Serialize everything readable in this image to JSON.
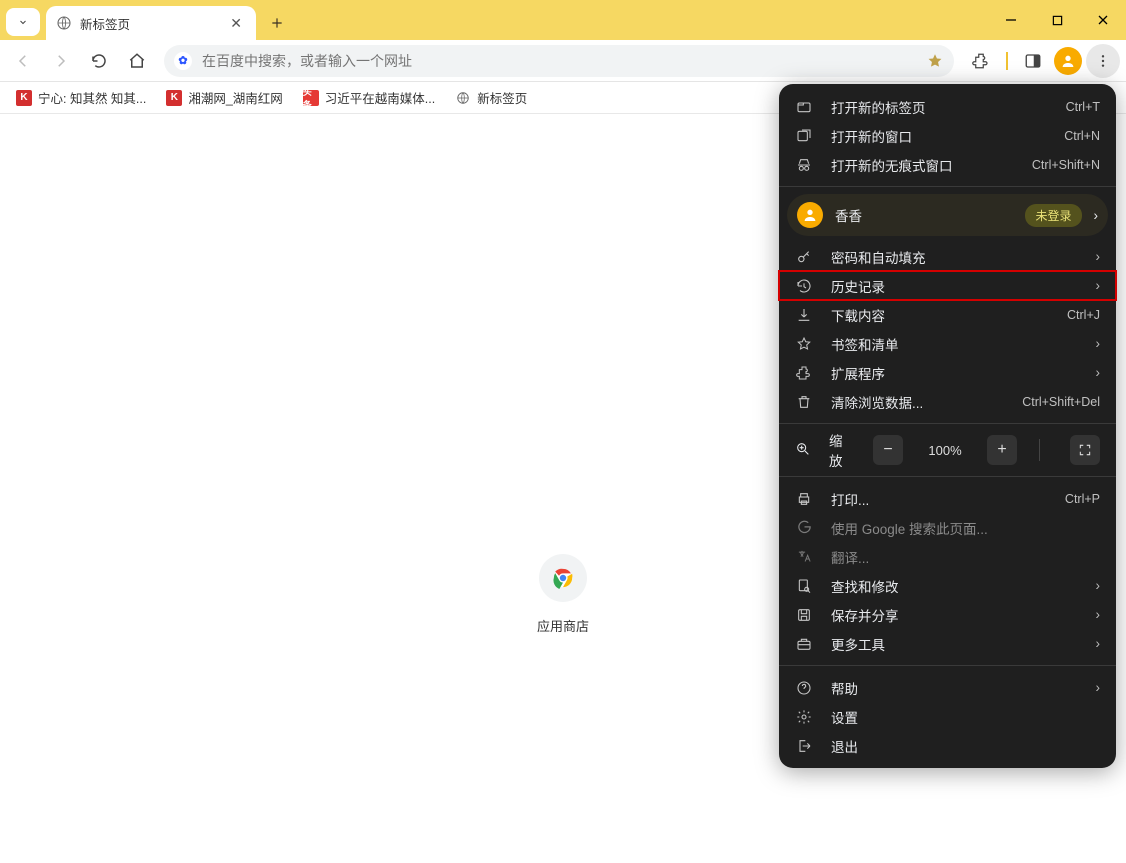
{
  "window": {
    "title": "新标签页"
  },
  "tab": {
    "label": "新标签页"
  },
  "addressbar": {
    "placeholder": "在百度中搜索，或者输入一个网址"
  },
  "bookmarks": [
    {
      "label": "宁心: 知其然 知其...",
      "icon": "red"
    },
    {
      "label": "湘潮网_湖南红网",
      "icon": "red"
    },
    {
      "label": "习近平在越南媒体...",
      "icon": "orange"
    },
    {
      "label": "新标签页",
      "icon": "globe"
    }
  ],
  "content": {
    "tile_label": "应用商店"
  },
  "menu": {
    "new_tab": {
      "label": "打开新的标签页",
      "shortcut": "Ctrl+T"
    },
    "new_window": {
      "label": "打开新的窗口",
      "shortcut": "Ctrl+N"
    },
    "incognito": {
      "label": "打开新的无痕式窗口",
      "shortcut": "Ctrl+Shift+N"
    },
    "profile": {
      "name": "香香",
      "badge": "未登录"
    },
    "passwords": {
      "label": "密码和自动填充"
    },
    "history": {
      "label": "历史记录"
    },
    "downloads": {
      "label": "下载内容",
      "shortcut": "Ctrl+J"
    },
    "bookmarks": {
      "label": "书签和清单"
    },
    "extensions": {
      "label": "扩展程序"
    },
    "clear_data": {
      "label": "清除浏览数据...",
      "shortcut": "Ctrl+Shift+Del"
    },
    "zoom": {
      "label": "缩放",
      "value": "100%"
    },
    "print": {
      "label": "打印...",
      "shortcut": "Ctrl+P"
    },
    "google_search": {
      "label": "使用 Google 搜索此页面..."
    },
    "translate": {
      "label": "翻译..."
    },
    "find": {
      "label": "查找和修改"
    },
    "save_share": {
      "label": "保存并分享"
    },
    "more_tools": {
      "label": "更多工具"
    },
    "help": {
      "label": "帮助"
    },
    "settings": {
      "label": "设置"
    },
    "exit": {
      "label": "退出"
    }
  }
}
